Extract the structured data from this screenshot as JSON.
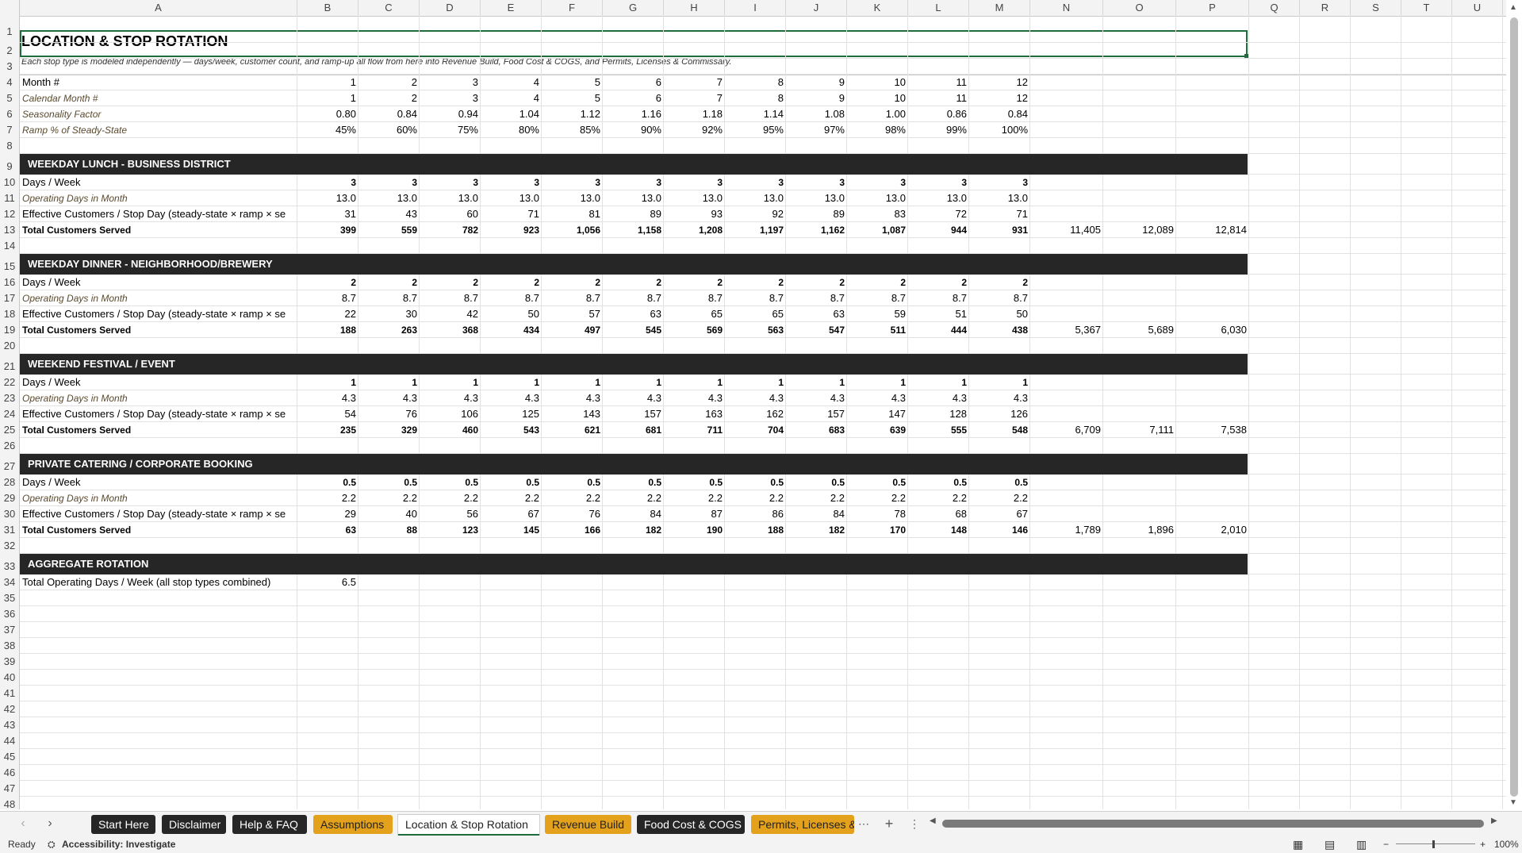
{
  "columns": [
    "A",
    "B",
    "C",
    "D",
    "E",
    "F",
    "G",
    "H",
    "I",
    "J",
    "K",
    "L",
    "M",
    "N",
    "O",
    "P",
    "Q",
    "R",
    "S",
    "T",
    "U"
  ],
  "title": "LOCATION & STOP ROTATION",
  "subtitle": "Each stop type is modeled independently — days/week, customer count, and ramp-up all flow from here into Revenue Build, Food Cost & COGS, and Permits, Licenses & Commissary.",
  "header_rows": {
    "month": {
      "label": "Month #",
      "values": [
        "1",
        "2",
        "3",
        "4",
        "5",
        "6",
        "7",
        "8",
        "9",
        "10",
        "11",
        "12"
      ]
    },
    "calendar": {
      "label": "Calendar Month #",
      "values": [
        "1",
        "2",
        "3",
        "4",
        "5",
        "6",
        "7",
        "8",
        "9",
        "10",
        "11",
        "12"
      ]
    },
    "seasonality": {
      "label": "Seasonality Factor",
      "values": [
        "0.80",
        "0.84",
        "0.94",
        "1.04",
        "1.12",
        "1.16",
        "1.18",
        "1.14",
        "1.08",
        "1.00",
        "0.86",
        "0.84"
      ]
    },
    "ramp": {
      "label": "Ramp % of Steady-State",
      "values": [
        "45%",
        "60%",
        "75%",
        "80%",
        "85%",
        "90%",
        "92%",
        "95%",
        "97%",
        "98%",
        "99%",
        "100%"
      ]
    }
  },
  "sections": [
    {
      "name": "WEEKDAY LUNCH - BUSINESS DISTRICT",
      "days_label": "Days / Week",
      "days": [
        "3",
        "3",
        "3",
        "3",
        "3",
        "3",
        "3",
        "3",
        "3",
        "3",
        "3",
        "3"
      ],
      "opdays_label": "Operating Days in Month",
      "opdays": [
        "13.0",
        "13.0",
        "13.0",
        "13.0",
        "13.0",
        "13.0",
        "13.0",
        "13.0",
        "13.0",
        "13.0",
        "13.0",
        "13.0"
      ],
      "eff_label": "Effective Customers / Stop Day (steady-state × ramp × se",
      "eff": [
        "31",
        "43",
        "60",
        "71",
        "81",
        "89",
        "93",
        "92",
        "89",
        "83",
        "72",
        "71"
      ],
      "total_label": "Total Customers Served",
      "total": [
        "399",
        "559",
        "782",
        "923",
        "1,056",
        "1,158",
        "1,208",
        "1,197",
        "1,162",
        "1,087",
        "944",
        "931"
      ],
      "annual": [
        "11,405",
        "12,089",
        "12,814"
      ]
    },
    {
      "name": "WEEKDAY DINNER - NEIGHBORHOOD/BREWERY",
      "days_label": "Days / Week",
      "days": [
        "2",
        "2",
        "2",
        "2",
        "2",
        "2",
        "2",
        "2",
        "2",
        "2",
        "2",
        "2"
      ],
      "opdays_label": "Operating Days in Month",
      "opdays": [
        "8.7",
        "8.7",
        "8.7",
        "8.7",
        "8.7",
        "8.7",
        "8.7",
        "8.7",
        "8.7",
        "8.7",
        "8.7",
        "8.7"
      ],
      "eff_label": "Effective Customers / Stop Day (steady-state × ramp × se",
      "eff": [
        "22",
        "30",
        "42",
        "50",
        "57",
        "63",
        "65",
        "65",
        "63",
        "59",
        "51",
        "50"
      ],
      "total_label": "Total Customers Served",
      "total": [
        "188",
        "263",
        "368",
        "434",
        "497",
        "545",
        "569",
        "563",
        "547",
        "511",
        "444",
        "438"
      ],
      "annual": [
        "5,367",
        "5,689",
        "6,030"
      ]
    },
    {
      "name": "WEEKEND FESTIVAL / EVENT",
      "days_label": "Days / Week",
      "days": [
        "1",
        "1",
        "1",
        "1",
        "1",
        "1",
        "1",
        "1",
        "1",
        "1",
        "1",
        "1"
      ],
      "opdays_label": "Operating Days in Month",
      "opdays": [
        "4.3",
        "4.3",
        "4.3",
        "4.3",
        "4.3",
        "4.3",
        "4.3",
        "4.3",
        "4.3",
        "4.3",
        "4.3",
        "4.3"
      ],
      "eff_label": "Effective Customers / Stop Day (steady-state × ramp × se",
      "eff": [
        "54",
        "76",
        "106",
        "125",
        "143",
        "157",
        "163",
        "162",
        "157",
        "147",
        "128",
        "126"
      ],
      "total_label": "Total Customers Served",
      "total": [
        "235",
        "329",
        "460",
        "543",
        "621",
        "681",
        "711",
        "704",
        "683",
        "639",
        "555",
        "548"
      ],
      "annual": [
        "6,709",
        "7,111",
        "7,538"
      ]
    },
    {
      "name": "PRIVATE CATERING / CORPORATE BOOKING",
      "days_label": "Days / Week",
      "days": [
        "0.5",
        "0.5",
        "0.5",
        "0.5",
        "0.5",
        "0.5",
        "0.5",
        "0.5",
        "0.5",
        "0.5",
        "0.5",
        "0.5"
      ],
      "opdays_label": "Operating Days in Month",
      "opdays": [
        "2.2",
        "2.2",
        "2.2",
        "2.2",
        "2.2",
        "2.2",
        "2.2",
        "2.2",
        "2.2",
        "2.2",
        "2.2",
        "2.2"
      ],
      "eff_label": "Effective Customers / Stop Day (steady-state × ramp × se",
      "eff": [
        "29",
        "40",
        "56",
        "67",
        "76",
        "84",
        "87",
        "86",
        "84",
        "78",
        "68",
        "67"
      ],
      "total_label": "Total Customers Served",
      "total": [
        "63",
        "88",
        "123",
        "145",
        "166",
        "182",
        "190",
        "188",
        "182",
        "170",
        "148",
        "146"
      ],
      "annual": [
        "1,789",
        "1,896",
        "2,010"
      ]
    }
  ],
  "aggregate": {
    "name": "AGGREGATE ROTATION",
    "label": "Total Operating Days / Week (all stop types combined)",
    "value": "6.5"
  },
  "tabs": [
    {
      "label": "Start Here",
      "style": "dark"
    },
    {
      "label": "Disclaimer",
      "style": "dark"
    },
    {
      "label": "Help & FAQ",
      "style": "dark"
    },
    {
      "label": "Assumptions",
      "style": "gold"
    },
    {
      "label": "Location & Stop Rotation",
      "style": "active"
    },
    {
      "label": "Revenue Build",
      "style": "gold"
    },
    {
      "label": "Food Cost & COGS",
      "style": "dark"
    },
    {
      "label": "Permits, Licenses &",
      "style": "gold"
    }
  ],
  "status": {
    "ready": "Ready",
    "accessibility": "Accessibility: Investigate",
    "zoom": "100%"
  }
}
